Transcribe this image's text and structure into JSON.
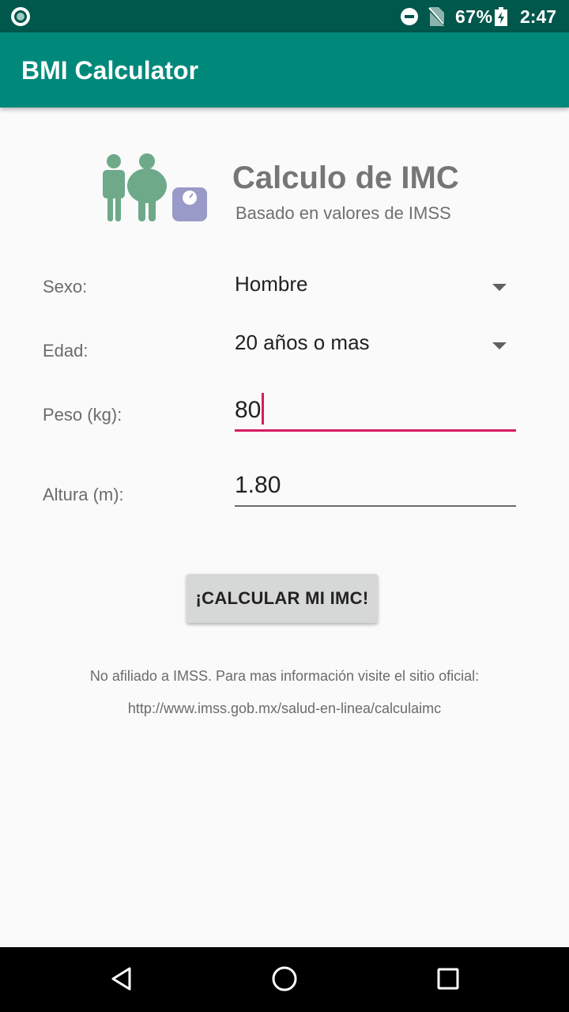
{
  "status_bar": {
    "battery": "67%",
    "time": "2:47",
    "icons": [
      "notification-dot-icon",
      "do-not-disturb-icon",
      "no-sim-icon",
      "battery-charging-icon"
    ]
  },
  "app_bar": {
    "title": "BMI Calculator"
  },
  "header": {
    "title": "Calculo de IMC",
    "subtitle": "Basado en valores de IMSS",
    "logo_icon": "people-scale-icon"
  },
  "form": {
    "sex": {
      "label": "Sexo:",
      "value": "Hombre"
    },
    "age": {
      "label": "Edad:",
      "value": "20 años o mas"
    },
    "weight": {
      "label": "Peso (kg):",
      "value": "80"
    },
    "height": {
      "label": "Altura (m):",
      "value": "1.80"
    }
  },
  "actions": {
    "calculate_label": "¡CALCULAR MI IMC!"
  },
  "footer": {
    "disclaimer": "No afiliado a IMSS. Para mas información visite el sitio oficial:",
    "link": "http://www.imss.gob.mx/salud-en-linea/calculaimc"
  },
  "nav_bar": {
    "buttons": [
      "back-icon",
      "home-icon",
      "recents-icon"
    ]
  },
  "colors": {
    "status_bar": "#00574b",
    "app_bar": "#00897b",
    "accent": "#d81b60",
    "logo_people": "#6ea98a",
    "logo_scale": "#9a9ac8"
  }
}
